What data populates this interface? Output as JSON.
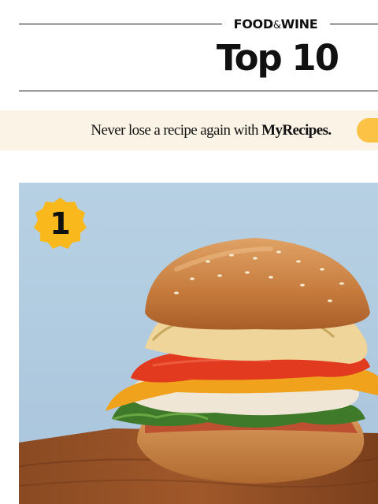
{
  "header": {
    "logo_left": "FOOD",
    "logo_amp": "&",
    "logo_right": "WINE",
    "title": "Top 10"
  },
  "promo": {
    "text_prefix": "Never lose a recipe again with ",
    "brand": "MyRecipes.",
    "button_color": "#fcc246",
    "background": "#fbf3e6"
  },
  "hero": {
    "rank": "1",
    "rank_badge_color": "#f9b91c",
    "image": "burger-photo"
  }
}
